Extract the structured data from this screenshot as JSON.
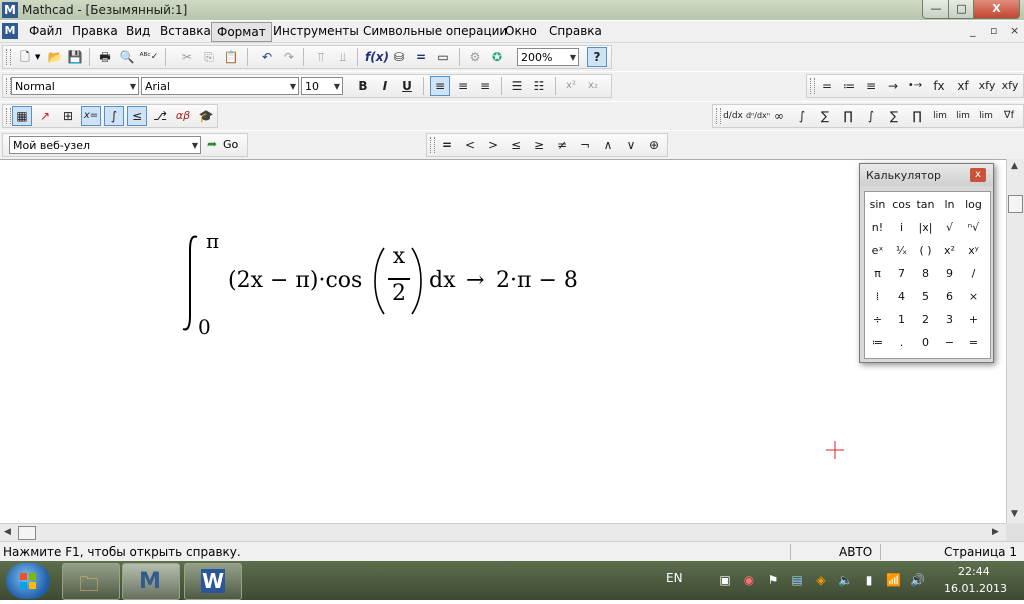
{
  "window": {
    "title": "Mathcad - [Безымянный:1]",
    "app_icon_letter": "M",
    "minimize": "—",
    "maximize": "□",
    "close": "X"
  },
  "menu": {
    "items": [
      "Файл",
      "Правка",
      "Вид",
      "Вставка",
      "Формат",
      "Инструменты",
      "Символьные операции",
      "Окно",
      "Справка"
    ],
    "active": "Формат",
    "doc_controls": [
      "_",
      "▫",
      "×"
    ]
  },
  "toolbar_standard": {
    "zoom": "200%",
    "help_icon": "?"
  },
  "toolbar_format": {
    "style": "Normal",
    "font": "Arial",
    "size": "10",
    "bold": "B",
    "italic": "I",
    "underline": "U",
    "superscript": "x²",
    "subscript": "x₂"
  },
  "toolbar_evaluation": [
    "=",
    "≔",
    "≡",
    "→",
    "•→",
    "fx",
    "xf",
    "xfy",
    "xfy"
  ],
  "toolbar_resources": {
    "site": "Мой веб-узел",
    "go": "Go"
  },
  "toolbar_boolean": [
    "=",
    "<",
    ">",
    "≤",
    "≥",
    "≠",
    "¬",
    "∧",
    "∨",
    "⊕"
  ],
  "toolbar_calculus": [
    "d/dx",
    "dⁿ/dxⁿ",
    "∞",
    "∫",
    "∑",
    "∏",
    "∫",
    "∑",
    "∏",
    "lim",
    "lim",
    "lim",
    "∇f"
  ],
  "math": {
    "upper_limit": "π",
    "lower_limit": "0",
    "integrand_left": "(2x − π)·cos",
    "frac_num": "x",
    "frac_den": "2",
    "dx": "dx",
    "arrow": "→",
    "result": "2·π − 8"
  },
  "calculator": {
    "title": "Калькулятор",
    "close": "x",
    "keys": [
      [
        "sin",
        "cos",
        "tan",
        "ln",
        "log"
      ],
      [
        "n!",
        "i",
        "|x|",
        "√",
        "ⁿ√"
      ],
      [
        "eˣ",
        "¹⁄ₓ",
        "( )",
        "x²",
        "xʸ"
      ],
      [
        "π",
        "7",
        "8",
        "9",
        "/"
      ],
      [
        "⁞",
        "4",
        "5",
        "6",
        "×"
      ],
      [
        "÷",
        "1",
        "2",
        "3",
        "+"
      ],
      [
        "≔",
        ".",
        "0",
        "−",
        "="
      ]
    ]
  },
  "status": {
    "hint": "Нажмите F1, чтобы открыть справку.",
    "mode": "АВТО",
    "page": "Страница 1"
  },
  "taskbar": {
    "language": "EN",
    "time": "22:44",
    "date": "16.01.2013",
    "word_letter": "W",
    "mathcad_letter": "M"
  }
}
